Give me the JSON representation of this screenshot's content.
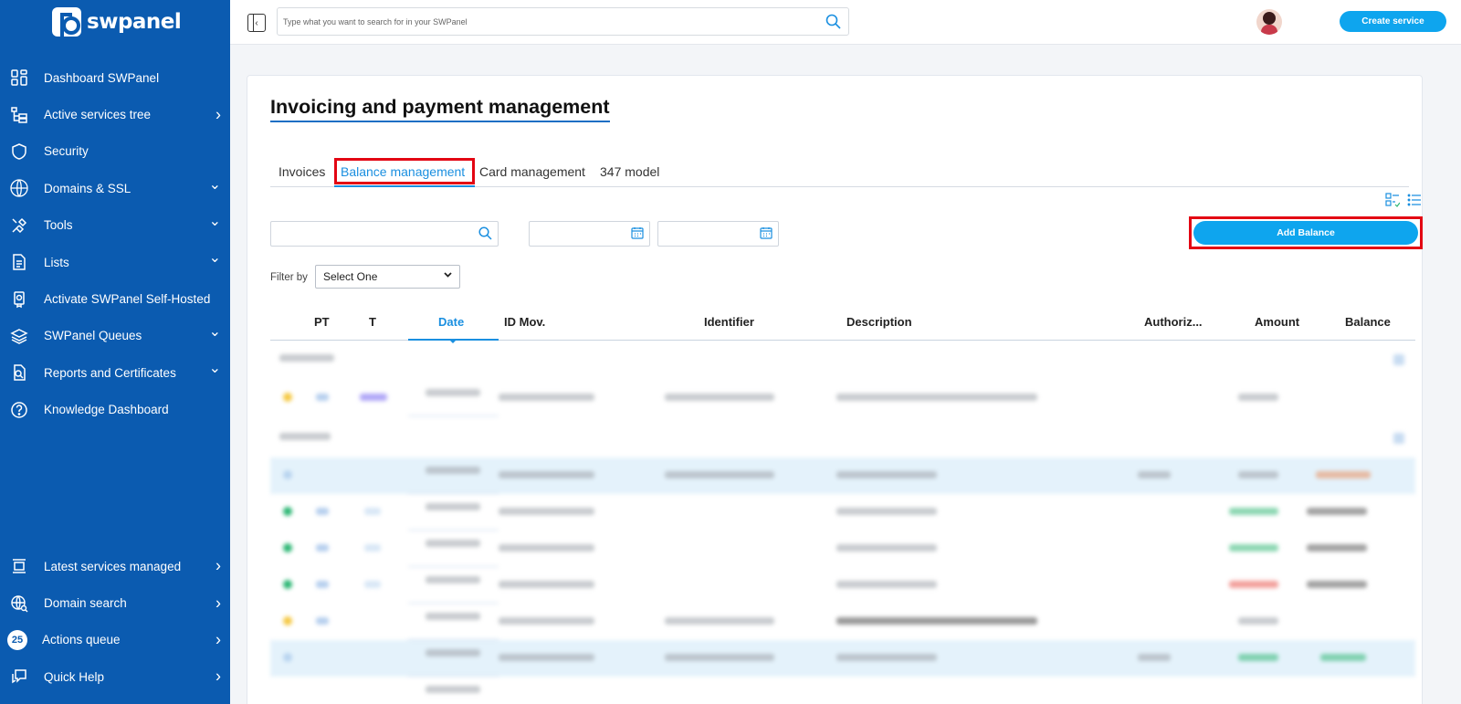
{
  "sidebar": {
    "logo": "swpanel",
    "items": [
      {
        "label": "Dashboard SWPanel",
        "icon": "dashboard-icon",
        "arrow": ""
      },
      {
        "label": "Active services tree",
        "icon": "tree-icon",
        "arrow": "›"
      },
      {
        "label": "Security",
        "icon": "shield-icon",
        "arrow": ""
      },
      {
        "label": "Domains & SSL",
        "icon": "globe-www-icon",
        "arrow": "⌄"
      },
      {
        "label": "Tools",
        "icon": "tools-icon",
        "arrow": "⌄"
      },
      {
        "label": "Lists",
        "icon": "document-icon",
        "arrow": "⌄"
      },
      {
        "label": "Activate SWPanel Self-Hosted",
        "icon": "certificate-icon",
        "arrow": ""
      },
      {
        "label": "SWPanel Queues",
        "icon": "layers-icon",
        "arrow": "⌄"
      },
      {
        "label": "Reports and Certificates",
        "icon": "report-icon",
        "arrow": "⌄"
      },
      {
        "label": "Knowledge Dashboard",
        "icon": "help-circle-icon",
        "arrow": ""
      }
    ],
    "bottom_items": [
      {
        "label": "Latest services managed",
        "icon": "carousel-icon",
        "arrow": "›"
      },
      {
        "label": "Domain search",
        "icon": "globe-search-icon",
        "arrow": "›"
      },
      {
        "label": "Actions queue",
        "badge": "25",
        "arrow": "›"
      },
      {
        "label": "Quick Help",
        "icon": "chat-icon",
        "arrow": "›"
      }
    ]
  },
  "topbar": {
    "search_placeholder": "Type what you want to search for in your SWPanel",
    "create_label": "Create service"
  },
  "page": {
    "title": "Invoicing and payment management",
    "tabs": [
      "Invoices",
      "Balance management",
      "Card management",
      "347 model"
    ],
    "active_tab": "Balance management",
    "add_balance_label": "Add Balance",
    "filter_label": "Filter by",
    "filter_value": "Select One"
  },
  "table": {
    "headers": [
      "PT",
      "T",
      "Date",
      "ID Mov.",
      "Identifier",
      "Description",
      "Authoriz...",
      "Amount",
      "Balance"
    ],
    "sorted_column": "Date"
  },
  "colors": {
    "sidebar": "#0b5bb0",
    "accent": "#0ea5ee",
    "highlight": "#e30613",
    "link": "#1a8fe0"
  }
}
